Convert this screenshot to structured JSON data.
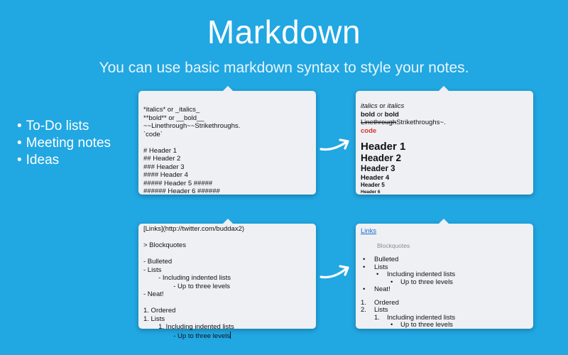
{
  "header": {
    "title": "Markdown",
    "subtitle": "You can use basic markdown syntax to style your notes."
  },
  "features": [
    "To-Do lists",
    "Meeting notes",
    "Ideas"
  ],
  "source_top": [
    "*italics* or _italics_",
    "**bold** or __bold__",
    "~~Linethrough~~Strikethroughs.",
    "`code`",
    "",
    "# Header 1",
    "## Header 2",
    "### Header 3",
    "#### Header 4",
    "##### Header 5 #####",
    "###### Header 6 ######"
  ],
  "rendered_top": {
    "italic_1": "italics",
    "or_1": " or ",
    "italic_2": "italics",
    "bold_1": "bold",
    "or_2": " or ",
    "bold_2": "bold",
    "strike": "Linethrough",
    "strike_after": "Strikethroughs~.",
    "code": "code",
    "h1": "Header 1",
    "h2": "Header 2",
    "h3": "Header 3",
    "h4": "Header 4",
    "h5": "Header 5",
    "h6": "Header 6"
  },
  "source_bottom": [
    "[Links](http://twitter.com/buddax2)",
    "",
    "> Blockquotes",
    "",
    "- Bulleted",
    "- Lists",
    "        - Including indented lists",
    "                - Up to three levels",
    "- Neat!",
    "",
    "1. Ordered",
    "1. Lists",
    "        1. Including indented lists",
    "                - Up to three levels"
  ],
  "rendered_bottom": {
    "link": "Links",
    "blockquote": "Blockquotes",
    "bullet_mark": "•",
    "sub_mark": "•",
    "bullets": [
      "Bulleted",
      "Lists"
    ],
    "sub_bullet": "Including indented lists",
    "sub_sub_bullet": "Up to three levels",
    "neat": "Neat!",
    "ordered_marks": [
      "1.",
      "2."
    ],
    "ordered": [
      "Ordered",
      "Lists"
    ],
    "ordered_sub_mark": "1.",
    "ordered_sub": "Including indented lists",
    "ordered_sub_sub": "Up to three levels"
  },
  "colors": {
    "background": "#21a7e2",
    "popover": "#eef0f3",
    "code": "#d9322b",
    "link": "#1a6fd1"
  }
}
